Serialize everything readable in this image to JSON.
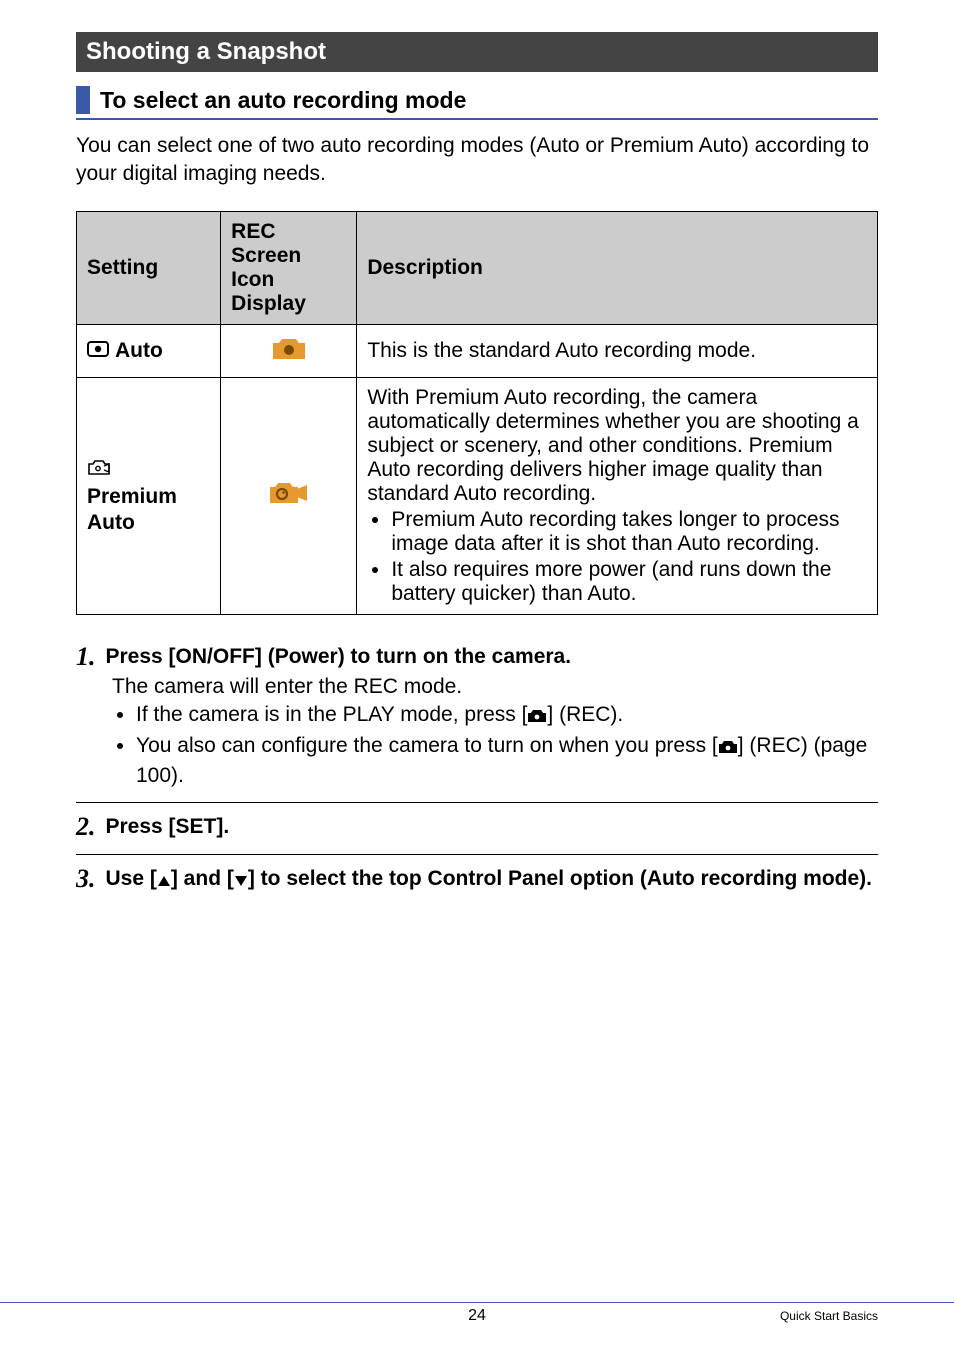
{
  "section_title": "Shooting a Snapshot",
  "subheading": "To select an auto recording mode",
  "intro": "You can select one of two auto recording modes (Auto or Premium Auto) according to your digital imaging needs.",
  "table": {
    "headers": {
      "setting": "Setting",
      "icon": "REC Screen Icon Display",
      "description": "Description"
    },
    "rows": {
      "auto": {
        "label": "Auto",
        "description": "This is the standard Auto recording mode."
      },
      "premium": {
        "label": "Premium Auto",
        "desc_intro": "With Premium Auto recording, the camera automatically determines whether you are shooting a subject or scenery, and other conditions. Premium Auto recording delivers higher image quality than standard Auto recording.",
        "bullet1": "Premium Auto recording takes longer to process image data after it is shot than Auto recording.",
        "bullet2": "It also requires more power (and runs down the battery quicker) than Auto."
      }
    }
  },
  "steps": {
    "s1": {
      "num": "1.",
      "title": "Press [ON/OFF] (Power) to turn on the camera.",
      "line1": "The camera will enter the REC mode.",
      "b1_a": "If the camera is in the PLAY mode, press [",
      "b1_b": "] (REC).",
      "b2_a": "You also can configure the camera to turn on when you press [",
      "b2_b": "] (REC) (page 100)."
    },
    "s2": {
      "num": "2.",
      "title": "Press [SET]."
    },
    "s3": {
      "num": "3.",
      "title_a": "Use [",
      "title_b": "] and [",
      "title_c": "] to select the top Control Panel option (Auto recording mode)."
    }
  },
  "footer": {
    "page": "24",
    "right": "Quick Start Basics"
  }
}
